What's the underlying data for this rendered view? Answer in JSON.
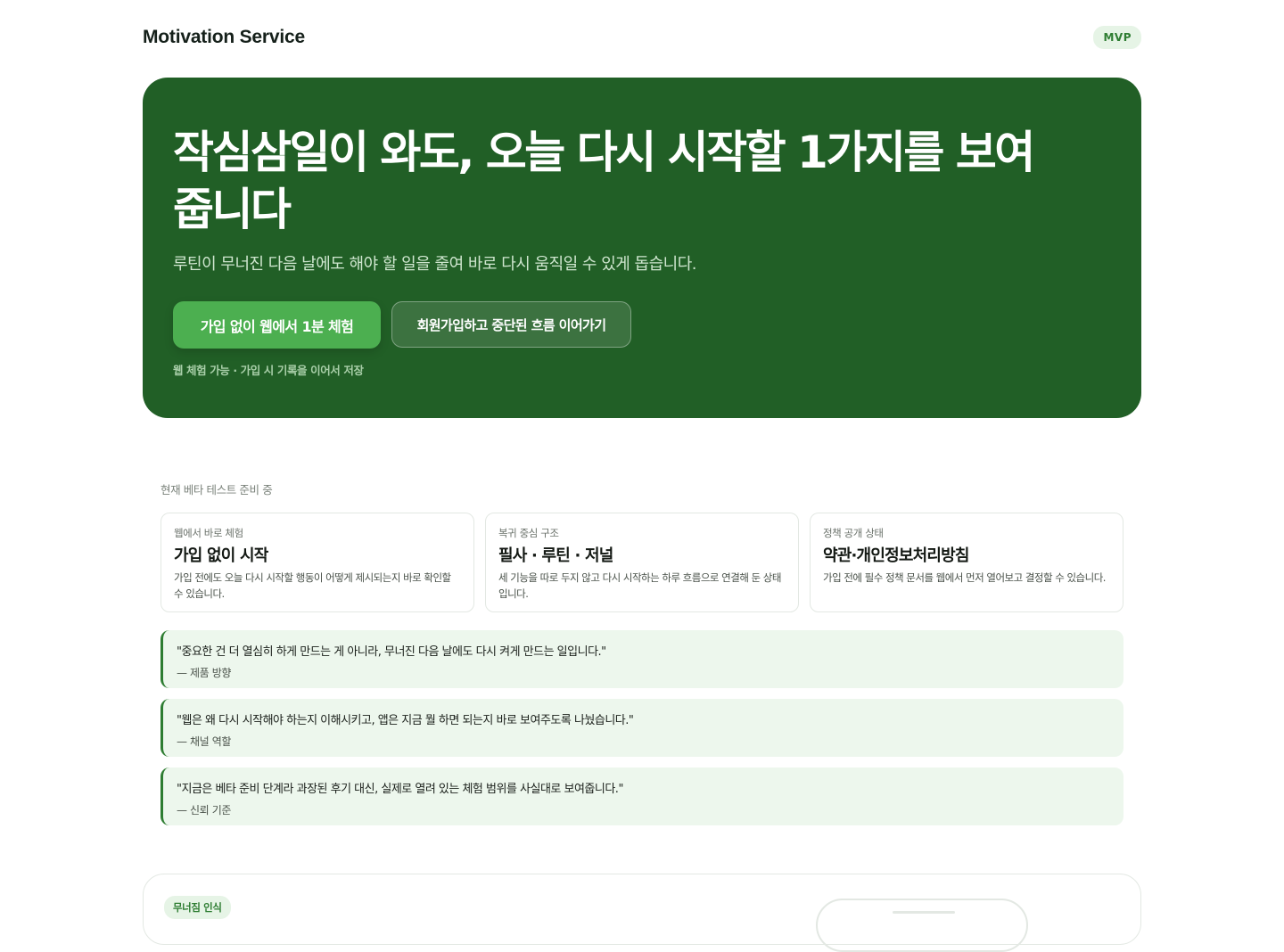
{
  "header": {
    "brand": "Motivation Service",
    "badge": "MVP"
  },
  "hero": {
    "title": "작심삼일이 와도, 오늘 다시 시작할 1가지를 보여줍니다",
    "subtitle": "루틴이 무너진 다음 날에도 해야 할 일을 줄여 바로 다시 움직일 수 있게 돕습니다.",
    "primary_cta": "가입 없이 웹에서 1분 체험",
    "secondary_cta": "회원가입하고 중단된 흐름 이어가기",
    "note": "웹 체험 가능 · 가입 시 기록을 이어서 저장"
  },
  "beta": {
    "label": "현재 베타 테스트 준비 중"
  },
  "cards": [
    {
      "kicker": "웹에서 바로 체험",
      "title": "가입 없이 시작",
      "desc": "가입 전에도 오늘 다시 시작할 행동이 어떻게 제시되는지 바로 확인할 수 있습니다."
    },
    {
      "kicker": "복귀 중심 구조",
      "title": "필사 · 루틴 · 저널",
      "desc": "세 기능을 따로 두지 않고 다시 시작하는 하루 흐름으로 연결해 둔 상태입니다."
    },
    {
      "kicker": "정책 공개 상태",
      "title": "약관·개인정보처리방침",
      "desc": "가입 전에 필수 정책 문서를 웹에서 먼저 열어보고 결정할 수 있습니다."
    }
  ],
  "quotes": [
    {
      "text": "\"중요한 건 더 열심히 하게 만드는 게 아니라, 무너진 다음 날에도 다시 켜게 만드는 일입니다.\"",
      "source": "— 제품 방향"
    },
    {
      "text": "\"웹은 왜 다시 시작해야 하는지 이해시키고, 앱은 지금 뭘 하면 되는지 바로 보여주도록 나눴습니다.\"",
      "source": "— 채널 역할"
    },
    {
      "text": "\"지금은 베타 준비 단계라 과장된 후기 대신, 실제로 열려 있는 체험 범위를 사실대로 보여줍니다.\"",
      "source": "— 신뢰 기준"
    }
  ],
  "bottom": {
    "badge": "무너짐 인식"
  },
  "colors": {
    "hero_bg": "#215f26",
    "primary": "#4caf50",
    "accent": "#2e7d32",
    "quote_bg": "#edf7ed"
  }
}
